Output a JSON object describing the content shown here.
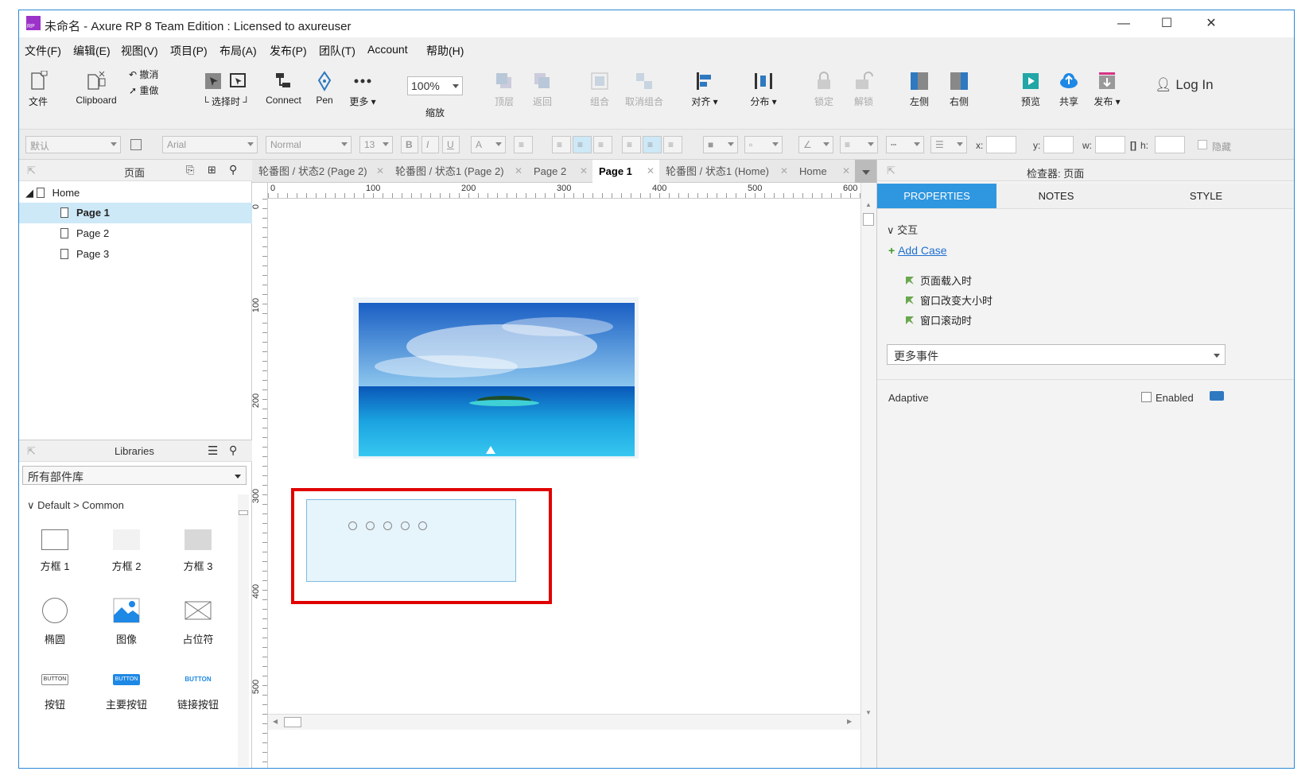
{
  "window": {
    "title": "未命名 - Axure RP 8 Team Edition : Licensed to axureuser",
    "minimize": "—",
    "maximize": "☐",
    "close": "✕"
  },
  "menu": [
    "文件(F)",
    "编辑(E)",
    "视图(V)",
    "项目(P)",
    "布局(A)",
    "发布(P)",
    "团队(T)",
    "Account",
    "帮助(H)"
  ],
  "toolbar": {
    "file": "文件",
    "clipboard": "Clipboard",
    "undo": "撤消",
    "redo": "重做",
    "select_mode": "└ 选择时 ┘",
    "connect": "Connect",
    "pen": "Pen",
    "more": "更多 ▾",
    "zoom_value": "100%",
    "zoom_label": "缩放",
    "top": "顶层",
    "back": "返回",
    "group": "组合",
    "ungroup": "取消组合",
    "align": "对齐 ▾",
    "distribute": "分布 ▾",
    "lock": "锁定",
    "unlock": "解锁",
    "left": "左侧",
    "right": "右侧",
    "preview": "预览",
    "share": "共享",
    "publish": "发布 ▾",
    "login": "Log In"
  },
  "format": {
    "style": "默认",
    "font": "Arial",
    "weight": "Normal",
    "size": "13",
    "bold": "B",
    "italic": "I",
    "underline": "U",
    "x_label": "x:",
    "y_label": "y:",
    "w_label": "w:",
    "h_label": "h:",
    "hidden": "隐藏"
  },
  "pages_panel": {
    "title": "页面",
    "root": "Home",
    "pages": [
      "Page 1",
      "Page 2",
      "Page 3"
    ]
  },
  "libraries": {
    "title": "Libraries",
    "selector": "所有部件库",
    "section": "Default > Common",
    "items": [
      "方框 1",
      "方框 2",
      "方框 3",
      "椭圆",
      "图像",
      "占位符",
      "按钮",
      "主要按钮",
      "链接按钮"
    ],
    "button_text": "BUTTON"
  },
  "tabs": [
    {
      "label": "轮番图 / 状态2 (Page 2)"
    },
    {
      "label": "轮番图 / 状态1 (Page 2)"
    },
    {
      "label": "Page 2"
    },
    {
      "label": "Page 1"
    },
    {
      "label": "轮番图 / 状态1 (Home)"
    },
    {
      "label": "Home"
    }
  ],
  "ruler": {
    "h": [
      "0",
      "100",
      "200",
      "300",
      "400",
      "500",
      "600"
    ],
    "v": [
      "0",
      "100",
      "200",
      "300",
      "400",
      "500"
    ]
  },
  "inspector": {
    "title": "检查器: 页面",
    "tabs": [
      "PROPERTIES",
      "NOTES",
      "STYLE"
    ],
    "section": "交互",
    "add_case": "Add Case",
    "events": [
      "页面载入时",
      "窗口改变大小时",
      "窗口滚动时"
    ],
    "more_events": "更多事件",
    "adaptive": "Adaptive",
    "enabled": "Enabled"
  },
  "colors": {
    "accent": "#2f97e0",
    "highlight": "#e00000",
    "selection": "#cde8f7",
    "widget_bg": "#e6f4fb"
  }
}
